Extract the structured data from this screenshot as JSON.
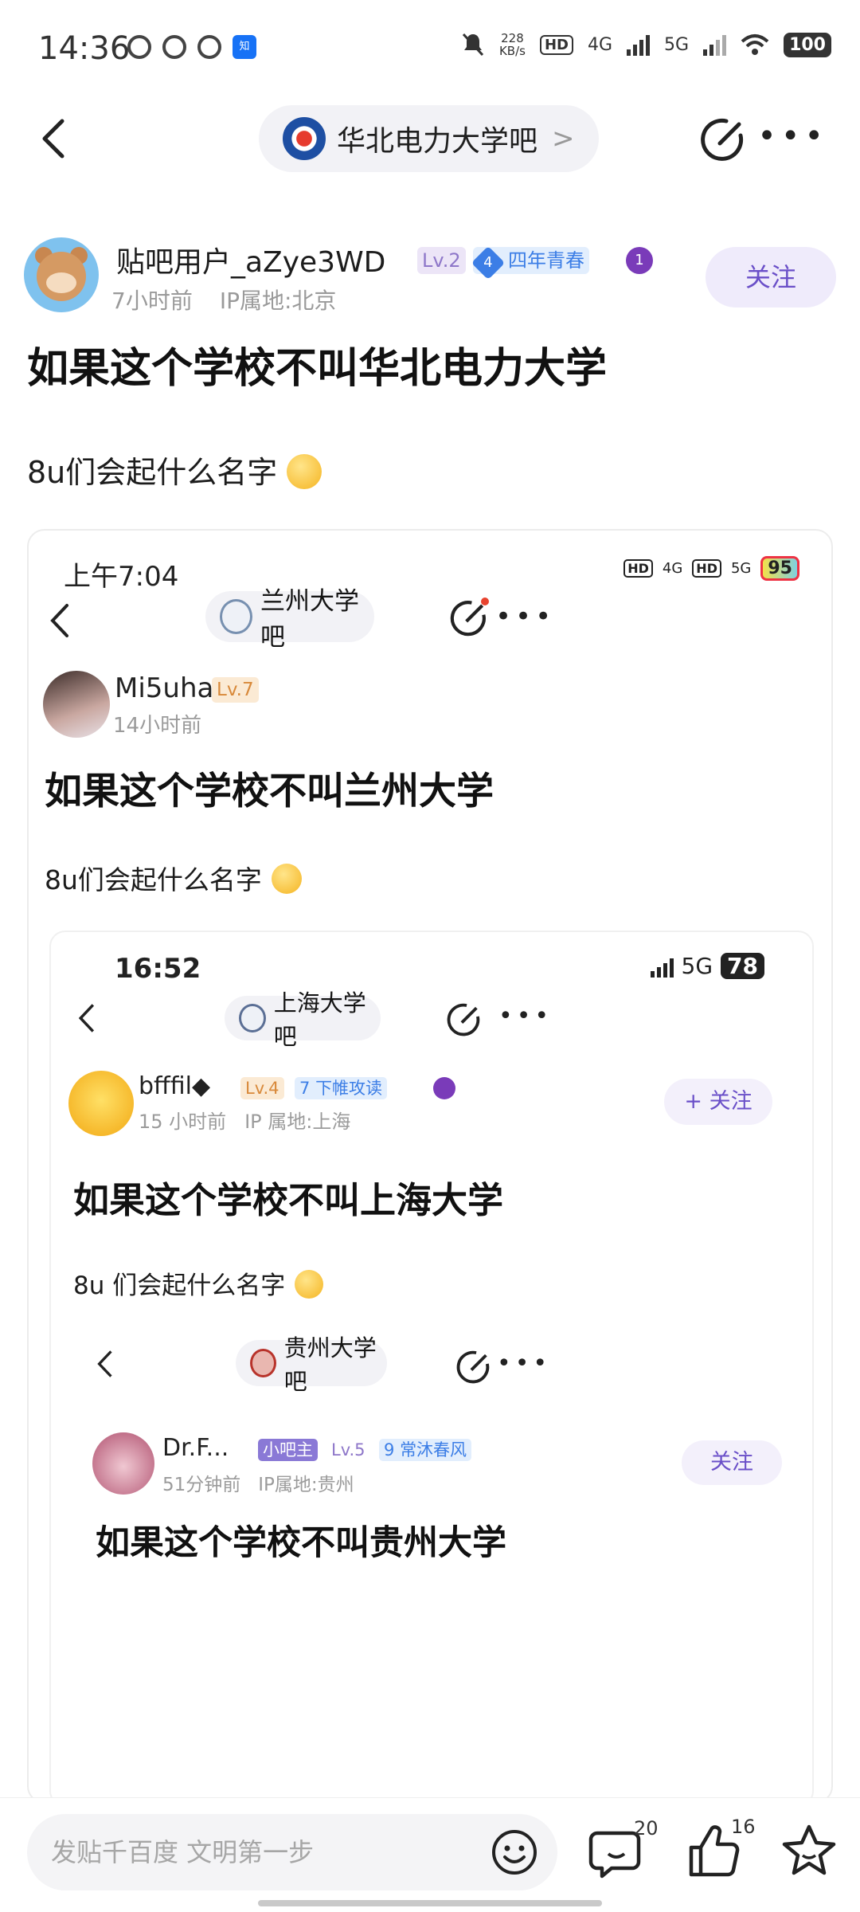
{
  "status_bar": {
    "time": "14:36",
    "speed_value": "228",
    "speed_unit": "KB/s",
    "hd_label": "HD",
    "net1": "4G",
    "net2": "5G",
    "battery": "100"
  },
  "header": {
    "forum_name": "华北电力大学吧",
    "chevron": ">"
  },
  "post": {
    "username": "贴吧用户_aZye3WD",
    "level": "Lv.2",
    "tag_number": "4",
    "tag_text": "四年青春",
    "medal": "1",
    "time": "7小时前",
    "ip": "IP属地:北京",
    "follow_label": "关注",
    "title": "如果这个学校不叫华北电力大学",
    "text": "8u们会起什么名字"
  },
  "embed": {
    "status_time": "上午7:04",
    "status_hd": "HD",
    "status_net1": "4G",
    "status_net2": "5G",
    "status_battery": "95",
    "forum_name": "兰州大学吧",
    "username": "Mi5uha",
    "level": "Lv.7",
    "time": "14小时前",
    "title": "如果这个学校不叫兰州大学",
    "text": "8u们会起什么名字",
    "inner": {
      "status_time": "16:52",
      "status_net": "5G",
      "status_battery": "78",
      "forum_name": "上海大学吧",
      "username": "bfffil◆",
      "level": "Lv.4",
      "tag_number": "7",
      "tag_text": "下帷攻读",
      "time": "15 小时前",
      "ip": "IP 属地:上海",
      "follow_label": "+ 关注",
      "title": "如果这个学校不叫上海大学",
      "text": "8u 们会起什么名字",
      "nested": {
        "forum_name": "贵州大学吧",
        "username": "Dr.F...",
        "role": "小吧主",
        "level": "Lv.5",
        "tag_number": "9",
        "tag_text": "常沐春风",
        "time": "51分钟前",
        "ip": "IP属地:贵州",
        "follow_label": "关注",
        "title": "如果这个学校不叫贵州大学"
      }
    }
  },
  "bottom_bar": {
    "composer_placeholder": "发贴千百度 文明第一步",
    "comment_count": "20",
    "like_count": "16"
  },
  "colors": {
    "accent": "#6a4fc8",
    "level_bg": "#ece5f7",
    "tag_blue": "#3c7ee6",
    "pill_bg": "#f2f2f6"
  },
  "icons": [
    "back-icon",
    "chevron-right-icon",
    "edit-icon",
    "more-icon",
    "emoji-icon",
    "comment-icon",
    "like-icon",
    "star-icon",
    "medal-icon"
  ]
}
